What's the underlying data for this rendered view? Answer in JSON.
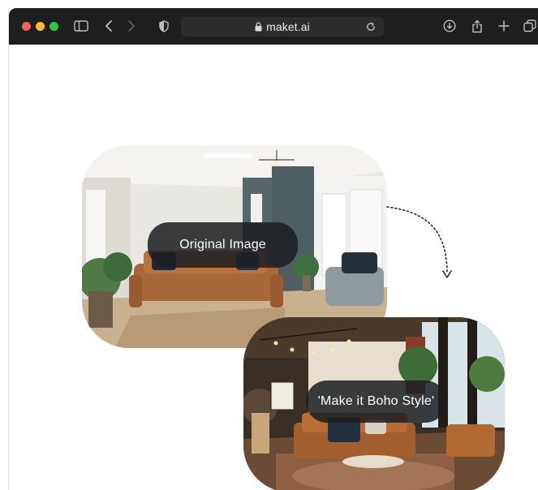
{
  "browser": {
    "url": "maket.ai",
    "colors": {
      "toolbar": "#1e1e1e",
      "address_bar": "#2c2c2c",
      "close": "#ff5f57",
      "minimize": "#febc2e",
      "zoom": "#28c840"
    },
    "icons": [
      "sidebar-toggle-icon",
      "chevron-left-icon",
      "chevron-right-icon",
      "shield-icon",
      "lock-icon",
      "reload-icon",
      "download-icon",
      "share-icon",
      "plus-icon",
      "tabs-icon"
    ]
  },
  "content": {
    "original": {
      "caption": "Original Image"
    },
    "styled": {
      "caption": "'Make it Boho Style'"
    }
  }
}
